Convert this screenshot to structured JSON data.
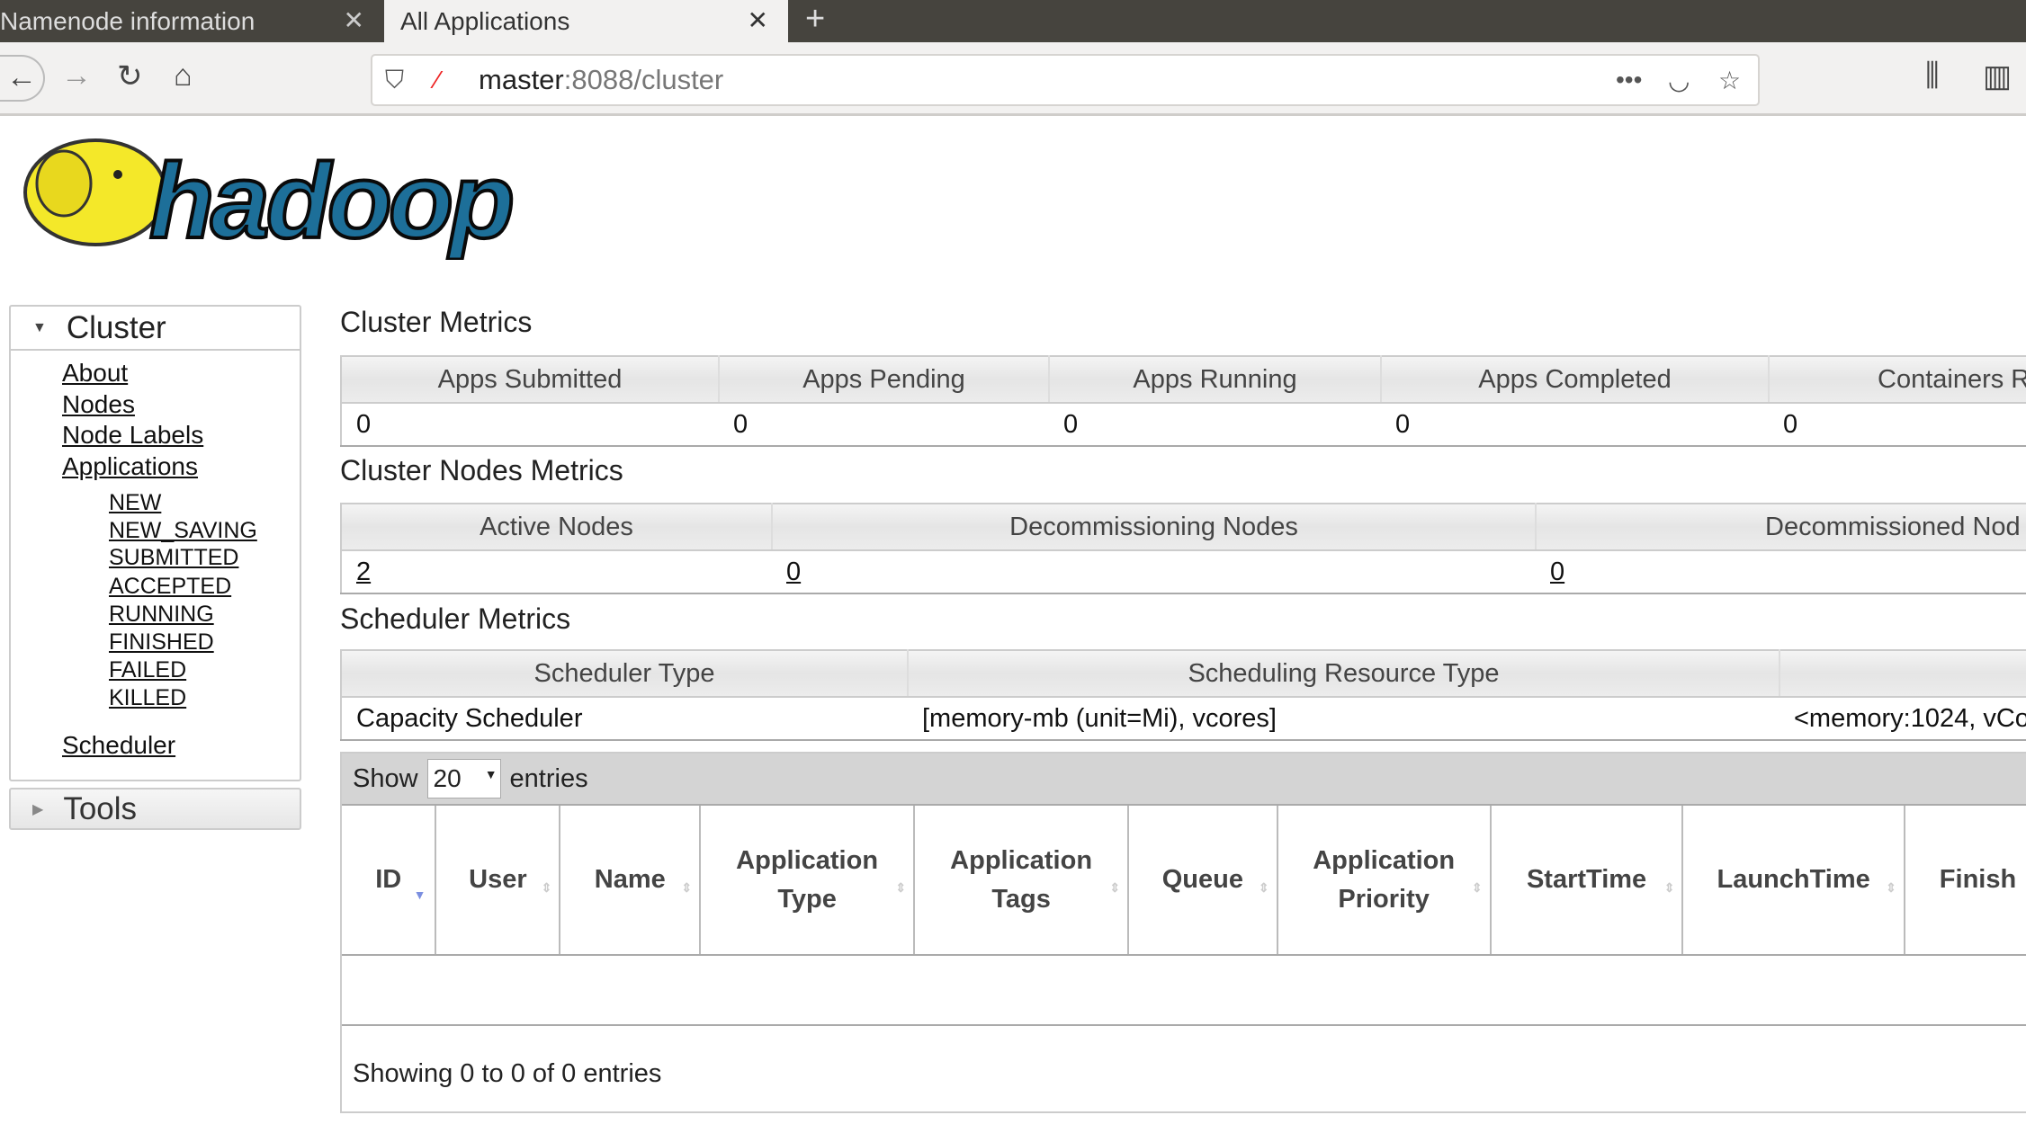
{
  "browser": {
    "tabs": [
      {
        "label": "Namenode information",
        "active": false
      },
      {
        "label": "All Applications",
        "active": true
      }
    ],
    "url_host": "master",
    "url_rest": ":8088/cluster"
  },
  "logo_text": "hadoop",
  "sidebar": {
    "cluster_label": "Cluster",
    "links": [
      "About",
      "Nodes",
      "Node Labels",
      "Applications"
    ],
    "app_states": [
      "NEW",
      "NEW_SAVING",
      "SUBMITTED",
      "ACCEPTED",
      "RUNNING",
      "FINISHED",
      "FAILED",
      "KILLED"
    ],
    "scheduler": "Scheduler",
    "tools_label": "Tools"
  },
  "cluster_metrics": {
    "title": "Cluster Metrics",
    "headers": [
      "Apps Submitted",
      "Apps Pending",
      "Apps Running",
      "Apps Completed",
      "Containers R"
    ],
    "values": [
      "0",
      "0",
      "0",
      "0",
      "0"
    ]
  },
  "nodes_metrics": {
    "title": "Cluster Nodes Metrics",
    "headers": [
      "Active Nodes",
      "Decommissioning Nodes",
      "Decommissioned Nod"
    ],
    "values": [
      "2",
      "0",
      "0"
    ]
  },
  "scheduler_metrics": {
    "title": "Scheduler Metrics",
    "headers": [
      "Scheduler Type",
      "Scheduling Resource Type",
      ""
    ],
    "values": [
      "Capacity Scheduler",
      "[memory-mb (unit=Mi), vcores]",
      "<memory:1024, vCo"
    ]
  },
  "apps_table": {
    "show": "Show",
    "entries": "entries",
    "page_size": "20",
    "columns": [
      "ID",
      "User",
      "Name",
      "Application Type",
      "Application Tags",
      "Queue",
      "Application Priority",
      "StartTime",
      "LaunchTime",
      "Finish"
    ],
    "info": "Showing 0 to 0 of 0 entries"
  }
}
